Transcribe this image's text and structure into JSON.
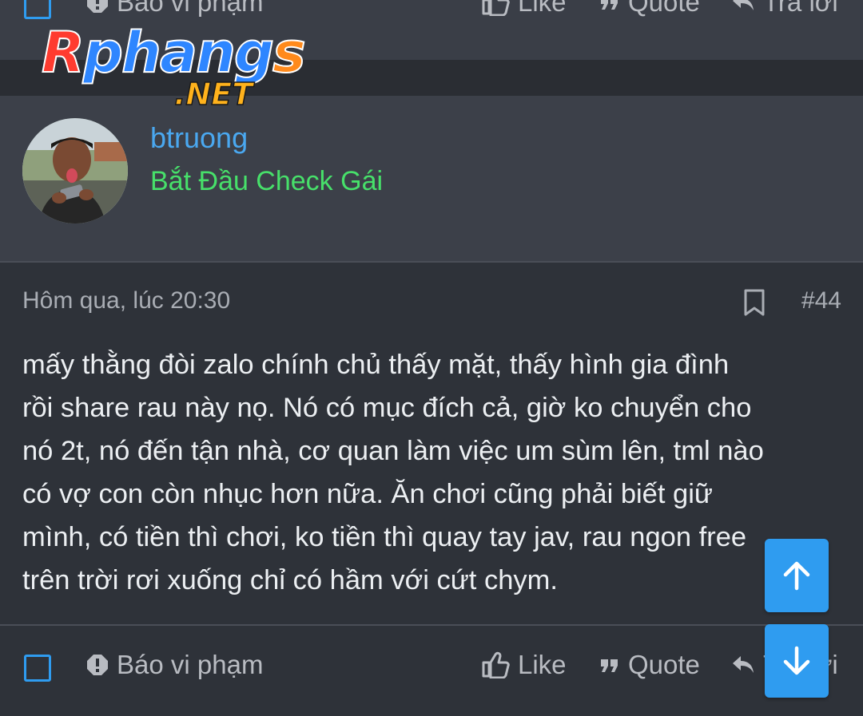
{
  "actions": {
    "report_label": "Báo vi phạm",
    "like_label": "Like",
    "quote_label": "Quote",
    "reply_label": "Trả lời"
  },
  "logo": {
    "main_text": "Rphangs",
    "suffix": ".NET"
  },
  "user": {
    "name": "btruong",
    "title": "Bắt Đầu Check Gái"
  },
  "post": {
    "timestamp": "Hôm qua, lúc 20:30",
    "number": "#44",
    "lines": [
      "mấy thằng đòi zalo chính chủ thấy mặt, thấy hình gia đình",
      "rồi share rau này nọ. Nó có mục đích cả, giờ ko chuyển cho",
      "nó 2t, nó đến tận nhà, cơ quan làm việc um sùm lên, tml nào",
      "có vợ con còn nhục hơn nữa. Ăn chơi cũng phải biết giữ",
      "mình, có tiền thì chơi, ko tiền thì quay tay jav, rau ngon free",
      "trên trời rơi xuống chỉ có hầm với cứt chym."
    ]
  },
  "colors": {
    "accent": "#2f9cf0",
    "username": "#4aa8f0",
    "user_title": "#47e06a",
    "background": "#2e3239"
  }
}
